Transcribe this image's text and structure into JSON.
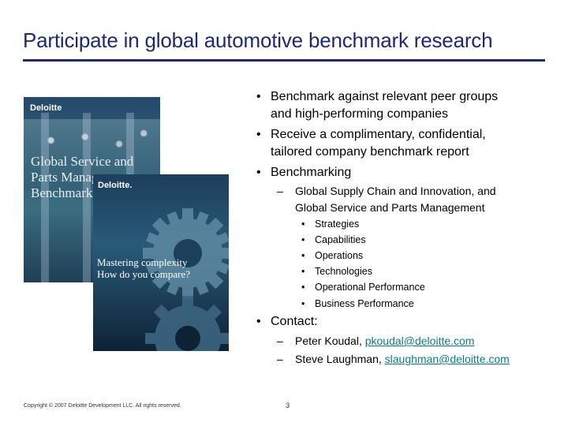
{
  "slide": {
    "title": "Participate in global automotive benchmark research",
    "page_number": "3",
    "footer": "Copyright © 2007 Deloitte Development LLC. All rights reserved."
  },
  "cover_back": {
    "brand": "Deloitte",
    "title_lines": [
      "Global Service and",
      "Parts Management",
      "Benchmark"
    ]
  },
  "cover_front": {
    "brand": "Deloitte.",
    "title_lines": [
      "Mastering complexity",
      "How do you compare?"
    ]
  },
  "bullets": {
    "b1": [
      "Benchmark against relevant peer groups",
      "and high-performing companies"
    ],
    "b2": [
      "Receive a complimentary, confidential,",
      "tailored company benchmark report"
    ],
    "b3": "Benchmarking",
    "benchmarking_sub": [
      "Global Supply Chain and Innovation, and",
      "Global Service and Parts Management"
    ],
    "areas": [
      "Strategies",
      "Capabilities",
      "Operations",
      "Technologies",
      "Operational Performance",
      "Business Performance"
    ],
    "contact": "Contact:",
    "contacts": [
      {
        "name": "Peter Koudal, ",
        "email": "pkoudal@deloitte.com"
      },
      {
        "name": "Steve Laughman, ",
        "email": "slaughman@deloitte.com"
      }
    ]
  },
  "colors": {
    "title": "#1d2a6b",
    "link": "#0f7b8a"
  }
}
